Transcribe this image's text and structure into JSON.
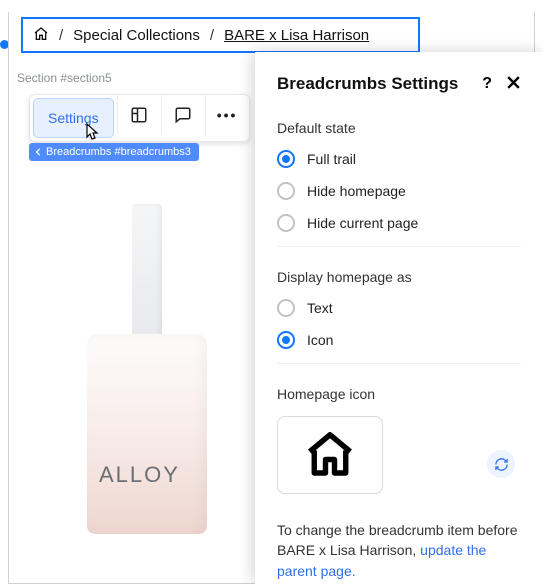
{
  "breadcrumb": {
    "items": [
      "Special Collections",
      "BARE x Lisa Harrison"
    ],
    "separator": "/"
  },
  "section_label": "Section #section5",
  "toolbar": {
    "settings": "Settings"
  },
  "tag_chip": "Breadcrumbs #breadcrumbs3",
  "product": {
    "brand": "ALLOY"
  },
  "panel": {
    "title": "Breadcrumbs Settings",
    "default_state": {
      "label": "Default state",
      "options": {
        "full": "Full trail",
        "hide_home": "Hide homepage",
        "hide_current": "Hide current page"
      },
      "selected": "full"
    },
    "display_as": {
      "label": "Display homepage as",
      "options": {
        "text": "Text",
        "icon": "Icon"
      },
      "selected": "icon"
    },
    "homepage_icon_label": "Homepage icon",
    "helper": {
      "prefix": "To change the breadcrumb item before BARE x Lisa Harrison, ",
      "link": "update the parent page."
    }
  }
}
